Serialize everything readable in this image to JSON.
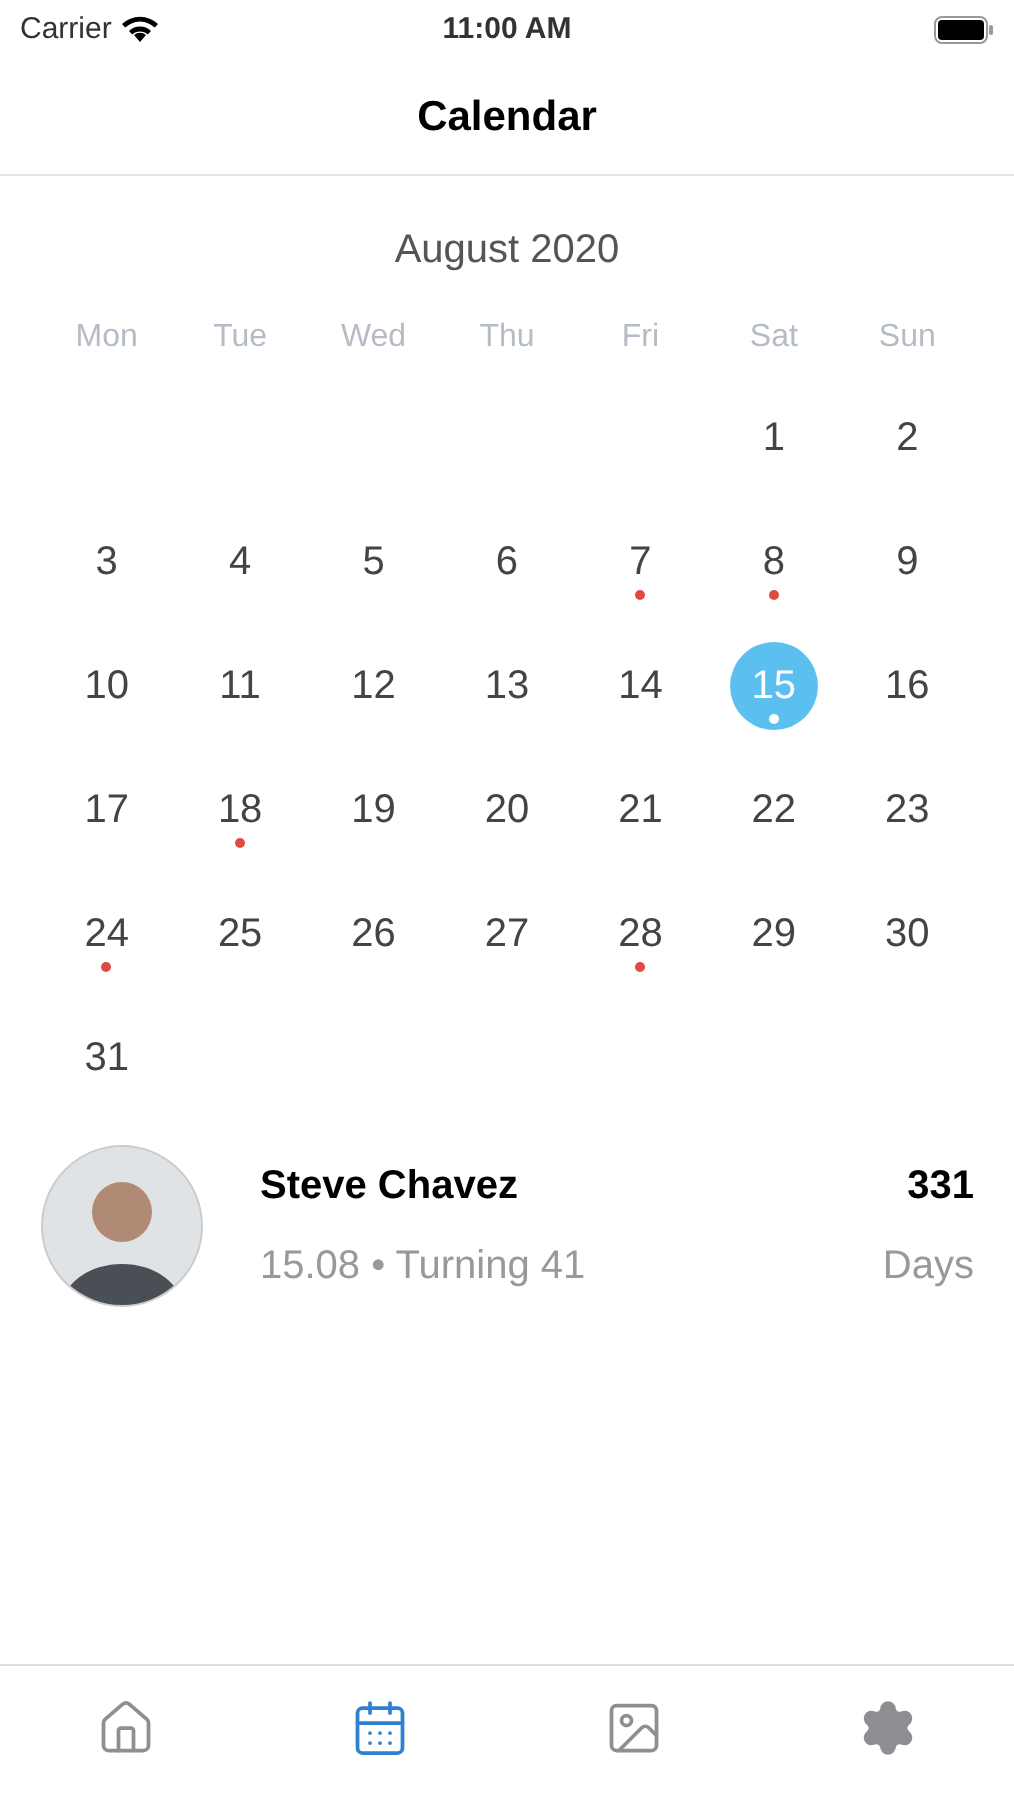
{
  "status_bar": {
    "carrier": "Carrier",
    "time": "11:00 AM"
  },
  "nav": {
    "title": "Calendar"
  },
  "calendar": {
    "month": "August 2020",
    "weekdays": [
      "Mon",
      "Tue",
      "Wed",
      "Thu",
      "Fri",
      "Sat",
      "Sun"
    ],
    "weeks": [
      [
        {
          "label": "1",
          "selected": false,
          "event": false
        },
        {
          "label": "2",
          "selected": false,
          "event": false
        }
      ],
      [
        {
          "label": "3",
          "selected": false,
          "event": false
        },
        {
          "label": "4",
          "selected": false,
          "event": false
        },
        {
          "label": "5",
          "selected": false,
          "event": false
        },
        {
          "label": "6",
          "selected": false,
          "event": false
        },
        {
          "label": "7",
          "selected": false,
          "event": true
        },
        {
          "label": "8",
          "selected": false,
          "event": true
        },
        {
          "label": "9",
          "selected": false,
          "event": false
        }
      ],
      [
        {
          "label": "10",
          "selected": false,
          "event": false
        },
        {
          "label": "11",
          "selected": false,
          "event": false
        },
        {
          "label": "12",
          "selected": false,
          "event": false
        },
        {
          "label": "13",
          "selected": false,
          "event": false
        },
        {
          "label": "14",
          "selected": false,
          "event": false
        },
        {
          "label": "15",
          "selected": true,
          "event": true
        },
        {
          "label": "16",
          "selected": false,
          "event": false
        }
      ],
      [
        {
          "label": "17",
          "selected": false,
          "event": false
        },
        {
          "label": "18",
          "selected": false,
          "event": true
        },
        {
          "label": "19",
          "selected": false,
          "event": false
        },
        {
          "label": "20",
          "selected": false,
          "event": false
        },
        {
          "label": "21",
          "selected": false,
          "event": false
        },
        {
          "label": "22",
          "selected": false,
          "event": false
        },
        {
          "label": "23",
          "selected": false,
          "event": false
        }
      ],
      [
        {
          "label": "24",
          "selected": false,
          "event": true
        },
        {
          "label": "25",
          "selected": false,
          "event": false
        },
        {
          "label": "26",
          "selected": false,
          "event": false
        },
        {
          "label": "27",
          "selected": false,
          "event": false
        },
        {
          "label": "28",
          "selected": false,
          "event": true
        },
        {
          "label": "29",
          "selected": false,
          "event": false
        },
        {
          "label": "30",
          "selected": false,
          "event": false
        }
      ],
      [
        {
          "label": "31",
          "selected": false,
          "event": false
        }
      ]
    ]
  },
  "birthdays": [
    {
      "name": "Steve Chavez",
      "subtitle": "15.08 • Turning 41",
      "count": "331",
      "unit": "Days"
    }
  ],
  "tabs": [
    {
      "kind": "home",
      "selected": false
    },
    {
      "kind": "calendar",
      "selected": true
    },
    {
      "kind": "cards",
      "selected": false
    },
    {
      "kind": "settings",
      "selected": false
    }
  ]
}
